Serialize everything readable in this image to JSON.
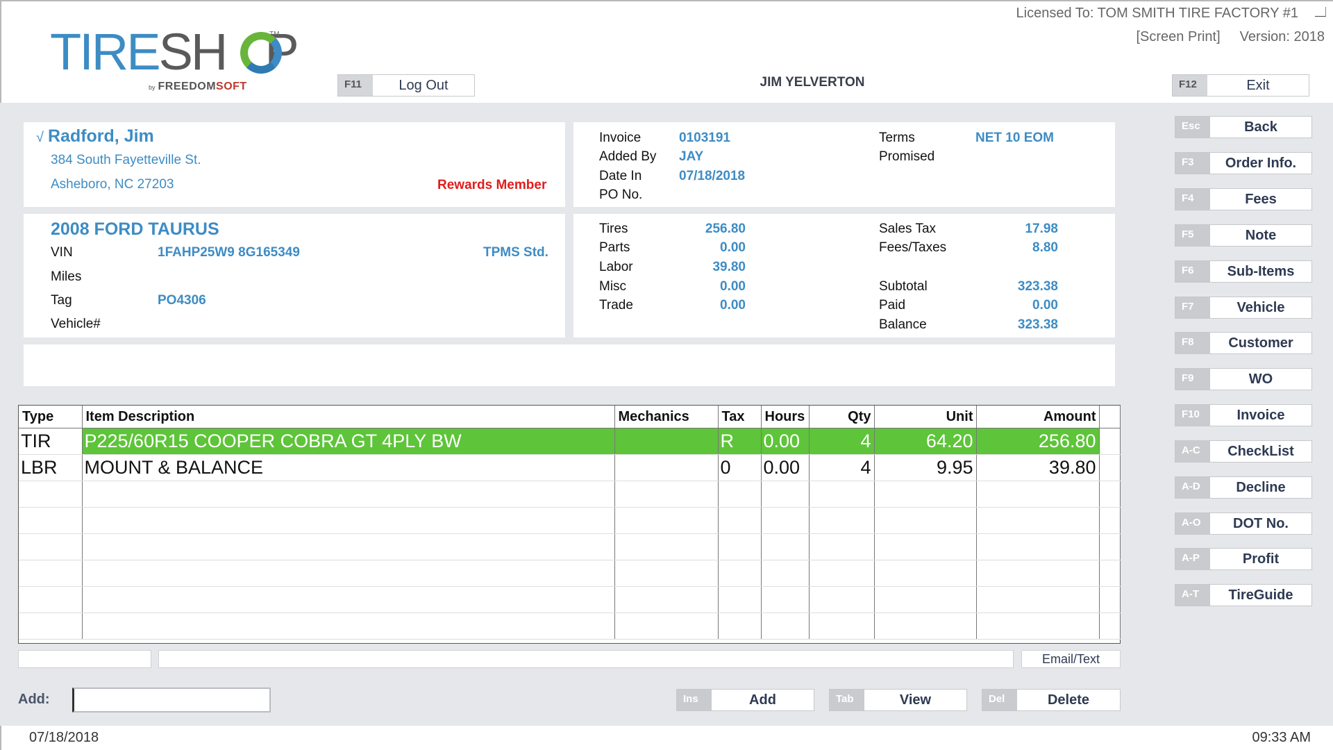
{
  "header": {
    "license": "Licensed To: TOM SMITH TIRE FACTORY #1",
    "screen_print": "[Screen Print]",
    "version": "Version: 2018",
    "user": "JIM YELVERTON",
    "logout": {
      "key": "F11",
      "label": "Log Out"
    },
    "exit": {
      "key": "F12",
      "label": "Exit"
    }
  },
  "logo": {
    "tire": "TIRE",
    "shop_s": "SH",
    "shop_p": "P",
    "tm": "TM",
    "by": "by",
    "freedom": "FREEDOM",
    "soft": "SOFT"
  },
  "customer": {
    "check": "√",
    "name": "Radford, Jim",
    "address1": "384 South Fayetteville St.",
    "address2": "Asheboro, NC  27203",
    "rewards": "Rewards Member"
  },
  "invoice_info": {
    "invoice_label": "Invoice",
    "invoice_value": "0103191",
    "added_by_label": "Added By",
    "added_by_value": "JAY",
    "date_in_label": "Date In",
    "date_in_value": "07/18/2018",
    "po_label": "PO No.",
    "terms_label": "Terms",
    "terms_value": "NET 10 EOM",
    "promised_label": "Promised"
  },
  "vehicle": {
    "title": "2008 FORD TAURUS",
    "vin_label": "VIN",
    "vin_value": "1FAHP25W9  8G165349",
    "tpms": "TPMS Std.",
    "miles_label": "Miles",
    "tag_label": "Tag",
    "tag_value": "PO4306",
    "vehicle_no_label": "Vehicle#"
  },
  "totals": {
    "tires_label": "Tires",
    "tires_value": "256.80",
    "parts_label": "Parts",
    "parts_value": "0.00",
    "labor_label": "Labor",
    "labor_value": "39.80",
    "misc_label": "Misc",
    "misc_value": "0.00",
    "trade_label": "Trade",
    "trade_value": "0.00",
    "sales_tax_label": "Sales Tax",
    "sales_tax_value": "17.98",
    "fees_label": "Fees/Taxes",
    "fees_value": "8.80",
    "subtotal_label": "Subtotal",
    "subtotal_value": "323.38",
    "paid_label": "Paid",
    "paid_value": "0.00",
    "balance_label": "Balance",
    "balance_value": "323.38"
  },
  "table": {
    "headers": {
      "type": "Type",
      "desc": "Item Description",
      "mech": "Mechanics",
      "tax": "Tax",
      "hours": "Hours",
      "qty": "Qty",
      "unit": "Unit",
      "amount": "Amount"
    },
    "rows": [
      {
        "type": "TIR",
        "desc": "P225/60R15   COOPER COBRA GT  4PLY BW",
        "mech": "",
        "tax": "R",
        "hours": "0.00",
        "qty": "4",
        "unit": "64.20",
        "amount": "256.80"
      },
      {
        "type": "LBR",
        "desc": "MOUNT & BALANCE",
        "mech": "",
        "tax": "0",
        "hours": "0.00",
        "qty": "4",
        "unit": "9.95",
        "amount": "39.80"
      }
    ]
  },
  "email_text": "Email/Text",
  "add": {
    "label": "Add:",
    "add_btn": {
      "key": "Ins",
      "label": "Add"
    },
    "view_btn": {
      "key": "Tab",
      "label": "View"
    },
    "delete_btn": {
      "key": "Del",
      "label": "Delete"
    }
  },
  "sidebar": [
    {
      "key": "Esc",
      "label": "Back"
    },
    {
      "key": "F3",
      "label": "Order Info."
    },
    {
      "key": "F4",
      "label": "Fees"
    },
    {
      "key": "F5",
      "label": "Note"
    },
    {
      "key": "F6",
      "label": "Sub-Items"
    },
    {
      "key": "F7",
      "label": "Vehicle"
    },
    {
      "key": "F8",
      "label": "Customer"
    },
    {
      "key": "F9",
      "label": "WO"
    },
    {
      "key": "F10",
      "label": "Invoice"
    },
    {
      "key": "A-C",
      "label": "CheckList"
    },
    {
      "key": "A-D",
      "label": "Decline"
    },
    {
      "key": "A-O",
      "label": "DOT No."
    },
    {
      "key": "A-P",
      "label": "Profit"
    },
    {
      "key": "A-T",
      "label": "TireGuide"
    }
  ],
  "status": {
    "date": "07/18/2018",
    "time": "09:33 AM"
  }
}
